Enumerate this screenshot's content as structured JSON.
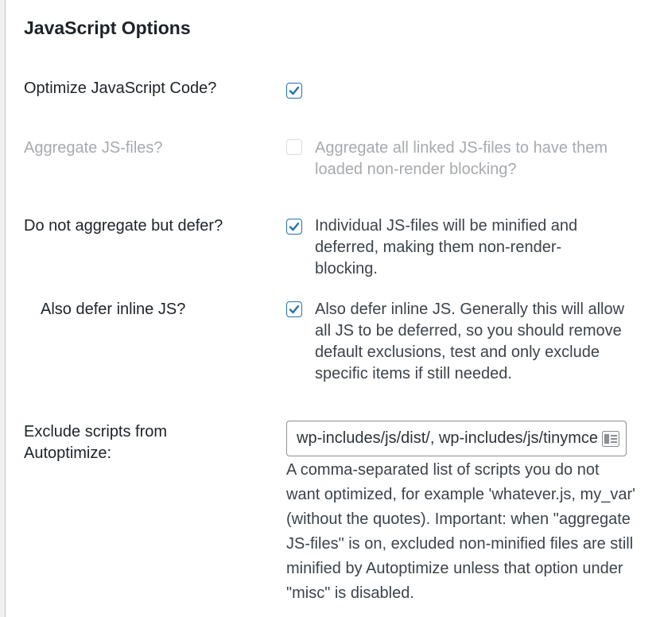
{
  "section": {
    "title": "JavaScript Options"
  },
  "optimize_js": {
    "label": "Optimize JavaScript Code?",
    "checked": true
  },
  "aggregate_js": {
    "label": "Aggregate JS-files?",
    "description": "Aggregate all linked JS-files to have them loaded non-render blocking?",
    "checked": false,
    "disabled": true
  },
  "defer_js": {
    "label": "Do not aggregate but defer?",
    "description": "Individual JS-files will be minified and deferred, making them non-render-blocking.",
    "checked": true
  },
  "defer_inline": {
    "label": "Also defer inline JS?",
    "description": "Also defer inline JS. Generally this will allow all JS to be deferred, so you should remove default exclusions, test and only exclude specific items if still needed.",
    "checked": true
  },
  "exclude_scripts": {
    "label": "Exclude scripts from Autoptimize:",
    "value": "wp-includes/js/dist/, wp-includes/js/tinymce/, js/jquery/jquery.js, js/jquery/jquery.min.js",
    "help": "A comma-separated list of scripts you do not want optimized, for example 'whatever.js, my_var' (without the quotes). Important: when \"aggregate JS-files\" is on, excluded non-minified files are still minified by Autoptimize unless that option under \"misc\" is disabled."
  },
  "colors": {
    "accent": "#2271b1",
    "text": "#1d2327",
    "muted": "#a7aaad",
    "description": "#3c434a"
  },
  "icons": {
    "checkmark": "checkmark-icon",
    "field_menu": "field-menu-icon"
  }
}
